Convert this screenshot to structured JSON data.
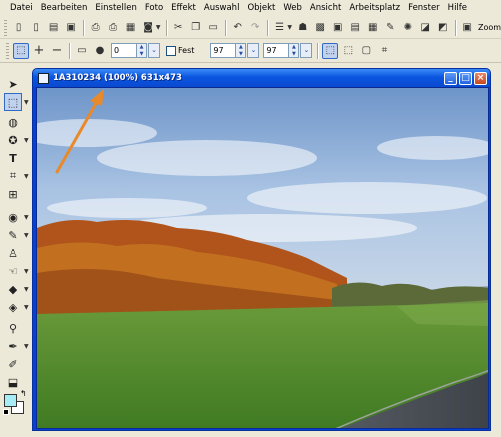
{
  "menu": [
    "Datei",
    "Bearbeiten",
    "Einstellen",
    "Foto",
    "Effekt",
    "Auswahl",
    "Objekt",
    "Web",
    "Ansicht",
    "Arbeitsplatz",
    "Fenster",
    "Hilfe"
  ],
  "toolbar2": {
    "value1": "0",
    "fixed_label": "Fest",
    "width": "97",
    "height": "97"
  },
  "zoom_label": "Zoom",
  "document": {
    "title": "1A310234 (100%) 631x473"
  },
  "colors": {
    "foreground": "#a7ecf5",
    "background": "#ffffff",
    "titlebar": "#0a55e0",
    "annotation_arrow": "#e8892a"
  }
}
